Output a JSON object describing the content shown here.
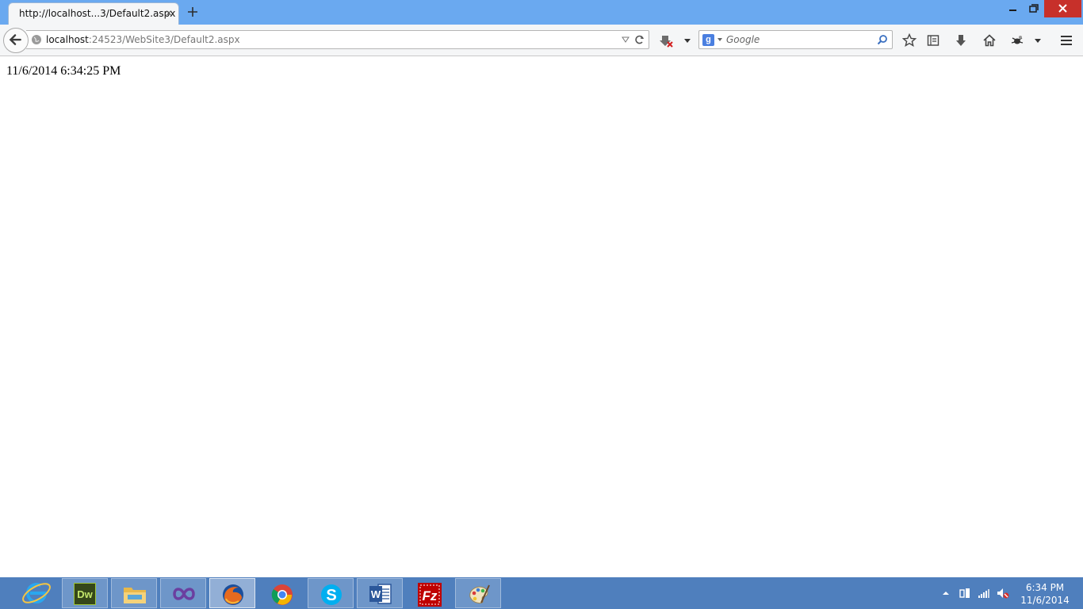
{
  "browser": {
    "tab_title": "http://localhost...3/Default2.aspx",
    "tab_close_glyph": "×",
    "url_host": "localhost",
    "url_rest": ":24523/WebSite3/Default2.aspx",
    "search_placeholder": "Google",
    "search_engine_letter": "g"
  },
  "page": {
    "datetime_text": "11/6/2014 6:34:25 PM"
  },
  "taskbar": {
    "pinned": [
      {
        "name": "internet-explorer-icon"
      },
      {
        "name": "dreamweaver-icon",
        "label": "Dw"
      },
      {
        "name": "file-explorer-icon"
      },
      {
        "name": "visual-studio-icon"
      },
      {
        "name": "firefox-icon",
        "active": true
      },
      {
        "name": "chrome-icon"
      },
      {
        "name": "skype-icon",
        "label": "S"
      },
      {
        "name": "word-icon",
        "label": "W"
      },
      {
        "name": "filezilla-icon",
        "label": "Fz"
      },
      {
        "name": "paint-icon"
      }
    ],
    "clock_time": "6:34 PM",
    "clock_date": "11/6/2014"
  },
  "colors": {
    "titlebar": "#6aa9f0",
    "taskbar": "#4f7fbd",
    "close_button": "#c7302a"
  }
}
